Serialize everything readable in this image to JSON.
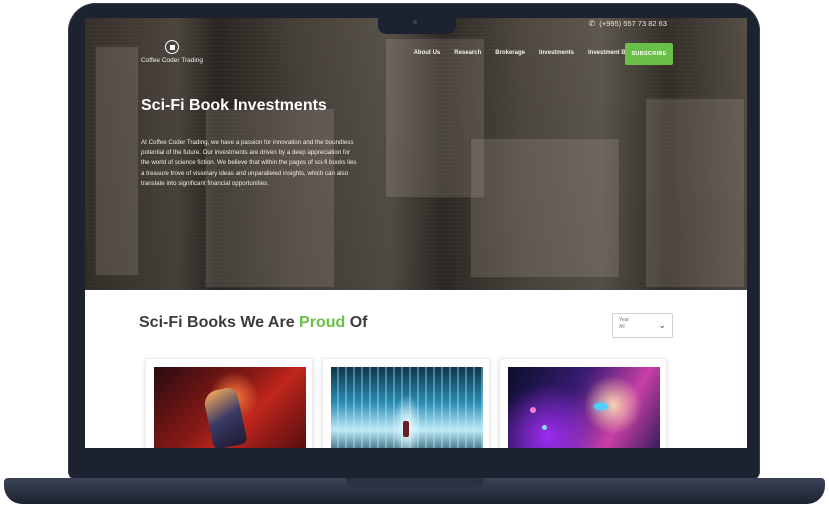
{
  "topbar": {
    "phone": "(+995) 557 73 82 63",
    "phone_icon": "phone-icon"
  },
  "brand": {
    "name": "Coffee Coder Trading",
    "logo_icon": "logo-mark-icon"
  },
  "nav": {
    "items": [
      "About Us",
      "Research",
      "Brokerage",
      "Investments",
      "Investment Banking"
    ],
    "cta": "SUBSCRIBE"
  },
  "hero": {
    "title": "Sci-Fi Book Investments",
    "text": "At Coffee Coder Trading, we have a passion for innovation and the boundless potential of the future. Our investments are driven by a deep appreciation for the world of science fiction. We believe that within the pages of sci-fi books lies a treasure trove of visionary ideas and unparalleled insights, which can also translate into significant financial opportunities."
  },
  "section": {
    "title_start": "Sci-Fi Books We Are ",
    "title_accent": "Proud",
    "title_end": " Of"
  },
  "filter": {
    "label": "Year",
    "value": "All",
    "icon": "chevron-down-icon"
  },
  "cards": [
    {
      "image": "robot-warrior"
    },
    {
      "image": "neon-tunnel"
    },
    {
      "image": "neon-face"
    }
  ],
  "colors": {
    "accent": "#6abf4b",
    "laptop": "#1d2230",
    "hero_overlay": "#19161a"
  }
}
